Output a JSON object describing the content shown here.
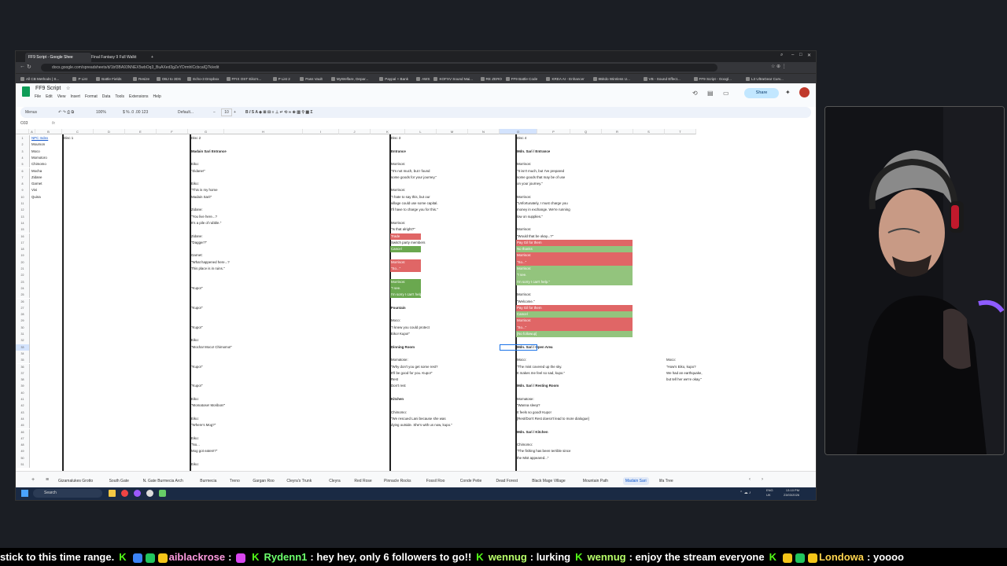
{
  "browser": {
    "tabs": [
      {
        "label": "FF9 Script - Google Shee",
        "active": true
      },
      {
        "label": "Final Fantasy 9 Full Walkt",
        "active": false
      }
    ],
    "new_tab": "+",
    "url": "docs.google.com/spreadsheets/d/1bf3BA93NNEX5wbOq3_BuAXed3gZeYDrmhlCcbcalQ7k/edit",
    "bookmarks": [
      "All CB Methods | S...",
      "P List",
      "Battle Fields",
      "Resize",
      "OBJ to 3DS",
      "Echo-3 Dropbox",
      "FFIX OST Eiko's...",
      "P List 2",
      "Pass Vault",
      "MyWelfare, Depar...",
      "Paypal + Bank",
      "AWS",
      "KOFXV Sound Mai...",
      "RE ZERO",
      "FF9 Battle Code",
      "KREA AI - Enhancer",
      "8Bitdo Wireless U...",
      "VB - Sound Effect...",
      "FF9 Script - Googl...",
      "L3 UltraGear Curv..."
    ]
  },
  "doc": {
    "title": "FF9 Script",
    "menus": [
      "File",
      "Edit",
      "View",
      "Insert",
      "Format",
      "Data",
      "Tools",
      "Extensions",
      "Help"
    ],
    "share_label": "Share",
    "toolbar": {
      "menus_label": "Menus",
      "zoom": "100%",
      "font": "Default...",
      "font_size": "10"
    },
    "name_box": "O33",
    "fx": "fx"
  },
  "sheet": {
    "columns": [
      "A",
      "B",
      "C",
      "D",
      "E",
      "F",
      "G",
      "H",
      "I",
      "J",
      "K",
      "L",
      "M",
      "N",
      "O",
      "P",
      "Q",
      "R",
      "S",
      "T"
    ],
    "headers": [
      "NPC Index",
      "Disc 1",
      "Disc 2",
      "Disc 3",
      "Disc 4"
    ],
    "npc_index": [
      "Moumon",
      "Moco",
      "Momotoro",
      "Chimomo",
      "Mocha",
      "Zidane",
      "Garnet",
      "Vivi",
      "Quina"
    ],
    "disc2": [
      {
        "r": 3,
        "t": "Madain Sari Entrance",
        "b": true
      },
      {
        "r": 5,
        "t": "Eiko:"
      },
      {
        "r": 6,
        "t": "\"Zidane!\""
      },
      {
        "r": 8,
        "t": "Eiko:"
      },
      {
        "r": 9,
        "t": "\"This is my home"
      },
      {
        "r": 10,
        "t": "Madain Sari!\""
      },
      {
        "r": 12,
        "t": "Zidane:"
      },
      {
        "r": 13,
        "t": "\"You live here...?"
      },
      {
        "r": 14,
        "t": "It's a pile of rubble.\""
      },
      {
        "r": 16,
        "t": "Zidane:"
      },
      {
        "r": 17,
        "t": "\"Dagger?\""
      },
      {
        "r": 19,
        "t": "Garnet:"
      },
      {
        "r": 20,
        "t": "\"What happened here...?"
      },
      {
        "r": 21,
        "t": "This place is in ruins.\""
      },
      {
        "r": 24,
        "t": "\"Kupo!\""
      },
      {
        "r": 27,
        "t": "\"Kupo!\""
      },
      {
        "r": 30,
        "t": "\"Kupo!\""
      },
      {
        "r": 32,
        "t": "Eiko:"
      },
      {
        "r": 33,
        "t": "\"Mocha! Moco! Chimomo!\""
      },
      {
        "r": 36,
        "t": "\"Kupo!\""
      },
      {
        "r": 39,
        "t": "\"Kupo!\""
      },
      {
        "r": 41,
        "t": "Eiko:"
      },
      {
        "r": 42,
        "t": "\"Momatose! Moribon!\""
      },
      {
        "r": 44,
        "t": "Eiko:"
      },
      {
        "r": 45,
        "t": "\"Where's Mog?\""
      },
      {
        "r": 47,
        "t": "Eiko:"
      },
      {
        "r": 48,
        "t": "\"No..."
      },
      {
        "r": 49,
        "t": "Mog got eaten!?\""
      },
      {
        "r": 51,
        "t": "Eiko:"
      }
    ],
    "disc3": [
      {
        "r": 3,
        "t": "Entrance",
        "b": true
      },
      {
        "r": 5,
        "t": "Morrison:"
      },
      {
        "r": 6,
        "t": "\"It's not much, but I found"
      },
      {
        "r": 7,
        "t": "some goods for your journey.\""
      },
      {
        "r": 9,
        "t": "Morrison:"
      },
      {
        "r": 10,
        "t": "\"I hate to say this, but our"
      },
      {
        "r": 11,
        "t": "village could use some capital."
      },
      {
        "r": 12,
        "t": "I'll have to charge you for this.\""
      },
      {
        "r": 14,
        "t": "Morrison:"
      },
      {
        "r": 15,
        "t": "\"Is that alright?\""
      },
      {
        "r": 16,
        "t": "Trade",
        "c": "red"
      },
      {
        "r": 17,
        "t": "Switch party members"
      },
      {
        "r": 18,
        "t": "Cancel",
        "c": "green"
      },
      {
        "r": 20,
        "t": "Morrison:",
        "c": "red"
      },
      {
        "r": 21,
        "t": "\"So...\"",
        "c": "red"
      },
      {
        "r": 23,
        "t": "Morrison:",
        "c": "green"
      },
      {
        "r": 24,
        "t": "\"I see.",
        "c": "green"
      },
      {
        "r": 25,
        "t": "I'm sorry I can't help.\"",
        "c": "green"
      },
      {
        "r": 27,
        "t": "Fountain",
        "b": true
      },
      {
        "r": 29,
        "t": "Moco:"
      },
      {
        "r": 30,
        "t": "\"I knew you could protect"
      },
      {
        "r": 31,
        "t": "Eiko! Kupo!\""
      },
      {
        "r": 33,
        "t": "Dinning Room",
        "b": true
      },
      {
        "r": 35,
        "t": "Momatose:"
      },
      {
        "r": 36,
        "t": "\"Why don't you get some rest?"
      },
      {
        "r": 37,
        "t": "It'll be good for you. Kupo!\""
      },
      {
        "r": 38,
        "t": "Rest"
      },
      {
        "r": 39,
        "t": "Don't rest"
      },
      {
        "r": 41,
        "t": "Kitchen",
        "b": true
      },
      {
        "r": 43,
        "t": "Chimomo:"
      },
      {
        "r": 44,
        "t": "\"We rescued Lani because she was"
      },
      {
        "r": 45,
        "t": "dying outside. She's with us now, kupo.\""
      }
    ],
    "disc4": [
      {
        "r": 3,
        "t": "Mdn. Sari / Entrance",
        "b": true
      },
      {
        "r": 5,
        "t": "Morrison:"
      },
      {
        "r": 6,
        "t": "\"It isn't much, but I've prepared"
      },
      {
        "r": 7,
        "t": "some goods that may be of use"
      },
      {
        "r": 8,
        "t": "on your journey.\""
      },
      {
        "r": 10,
        "t": "Morrison:"
      },
      {
        "r": 11,
        "t": "\"Unfortunately, I must charge you"
      },
      {
        "r": 12,
        "t": "money in exchange. We're running"
      },
      {
        "r": 13,
        "t": "low on supplies.\""
      },
      {
        "r": 15,
        "t": "Morrison:"
      },
      {
        "r": 16,
        "t": "\"Would that be okay...?\""
      },
      {
        "r": 17,
        "t": "Pay Gil for them",
        "c": "red"
      },
      {
        "r": 18,
        "t": "No thanks",
        "c": "green2"
      },
      {
        "r": 19,
        "t": "Morrison:",
        "c": "red"
      },
      {
        "r": 20,
        "t": "\"So...\"",
        "c": "red"
      },
      {
        "r": 21,
        "t": "Morrison:",
        "c": "green2"
      },
      {
        "r": 22,
        "t": "\"I see.",
        "c": "green2"
      },
      {
        "r": 23,
        "t": "I'm sorry I can't help.\"",
        "c": "green2"
      },
      {
        "r": 25,
        "t": "Morrison:"
      },
      {
        "r": 26,
        "t": "\"Welcome.\""
      },
      {
        "r": 27,
        "t": "Pay Gil for them",
        "c": "red"
      },
      {
        "r": 28,
        "t": "Cancel",
        "c": "green2"
      },
      {
        "r": 29,
        "t": "Morrison:",
        "c": "red"
      },
      {
        "r": 30,
        "t": "\"So...\"",
        "c": "red"
      },
      {
        "r": 31,
        "t": "[No followup]",
        "c": "green2"
      },
      {
        "r": 33,
        "t": "Mdn. Sari / Open Area",
        "b": true
      },
      {
        "r": 35,
        "t": "Moco:"
      },
      {
        "r": 36,
        "t": "\"The mist covered up the sky."
      },
      {
        "r": 37,
        "t": "It makes me feel so sad, kupo.\""
      },
      {
        "r": 39,
        "t": "Mdn. Sari / Resting Room",
        "b": true
      },
      {
        "r": 41,
        "t": "Momatose:"
      },
      {
        "r": 42,
        "t": "\"Wanna sleep?"
      },
      {
        "r": 43,
        "t": "It feels so good! Kupo!"
      },
      {
        "r": 44,
        "t": "[Rest/Don't Rest doesn't lead to more dialogue]"
      },
      {
        "r": 46,
        "t": "Mdn. Sari / Kitchen",
        "b": true
      },
      {
        "r": 48,
        "t": "Chimomo:"
      },
      {
        "r": 49,
        "t": "\"The fishing has been terrible since"
      },
      {
        "r": 50,
        "t": "the Mist appeared...\""
      }
    ],
    "colP": [
      {
        "r": 35,
        "t": "Moco:"
      },
      {
        "r": 36,
        "t": "\"How's Eiko, kupo?"
      },
      {
        "r": 37,
        "t": "We had an earthquake,"
      },
      {
        "r": 38,
        "t": "but tell her we're okay.\""
      }
    ],
    "tabs": [
      "Gizamalukes Grotto",
      "South Gate",
      "N. Gate Burmecia Arch",
      "Burmecia",
      "Treno",
      "Gargan Roo",
      "Cleyra's Trunk",
      "Cleyra",
      "Red Rose",
      "Pinnacle Rocks",
      "Fossil Roo",
      "Conde Petie",
      "Dead Forest",
      "Black Mage Village",
      "Mountain Path",
      "Madain Sari",
      "Iifa Tree"
    ],
    "active_tab": "Madain Sari"
  },
  "taskbar": {
    "search": "Search",
    "lang": "ENG\nUK",
    "time": "13:10 PM",
    "date": "23/03/2026"
  },
  "ticker": [
    {
      "type": "text",
      "text": "stick to this time range."
    },
    {
      "type": "user",
      "user": "aiblackrose",
      "text": "",
      "cls": "u-pink"
    },
    {
      "type": "user",
      "user": "Rydenn1",
      "text": "hey hey, only 6 followers to go!!",
      "cls": "u-green"
    },
    {
      "type": "user",
      "user": "wennug",
      "text": "lurking",
      "cls": "u-lime"
    },
    {
      "type": "user",
      "user": "wennug",
      "text": "enjoy the stream everyone",
      "cls": "u-lime"
    },
    {
      "type": "user",
      "user": "Londowa",
      "text": "yoooo",
      "cls": "u-gold"
    }
  ],
  "colors": {
    "red_cell": "#e06666",
    "green_cell": "#6aa84f",
    "green_cell_light": "#93c47d",
    "kick_green": "#53fc18"
  }
}
